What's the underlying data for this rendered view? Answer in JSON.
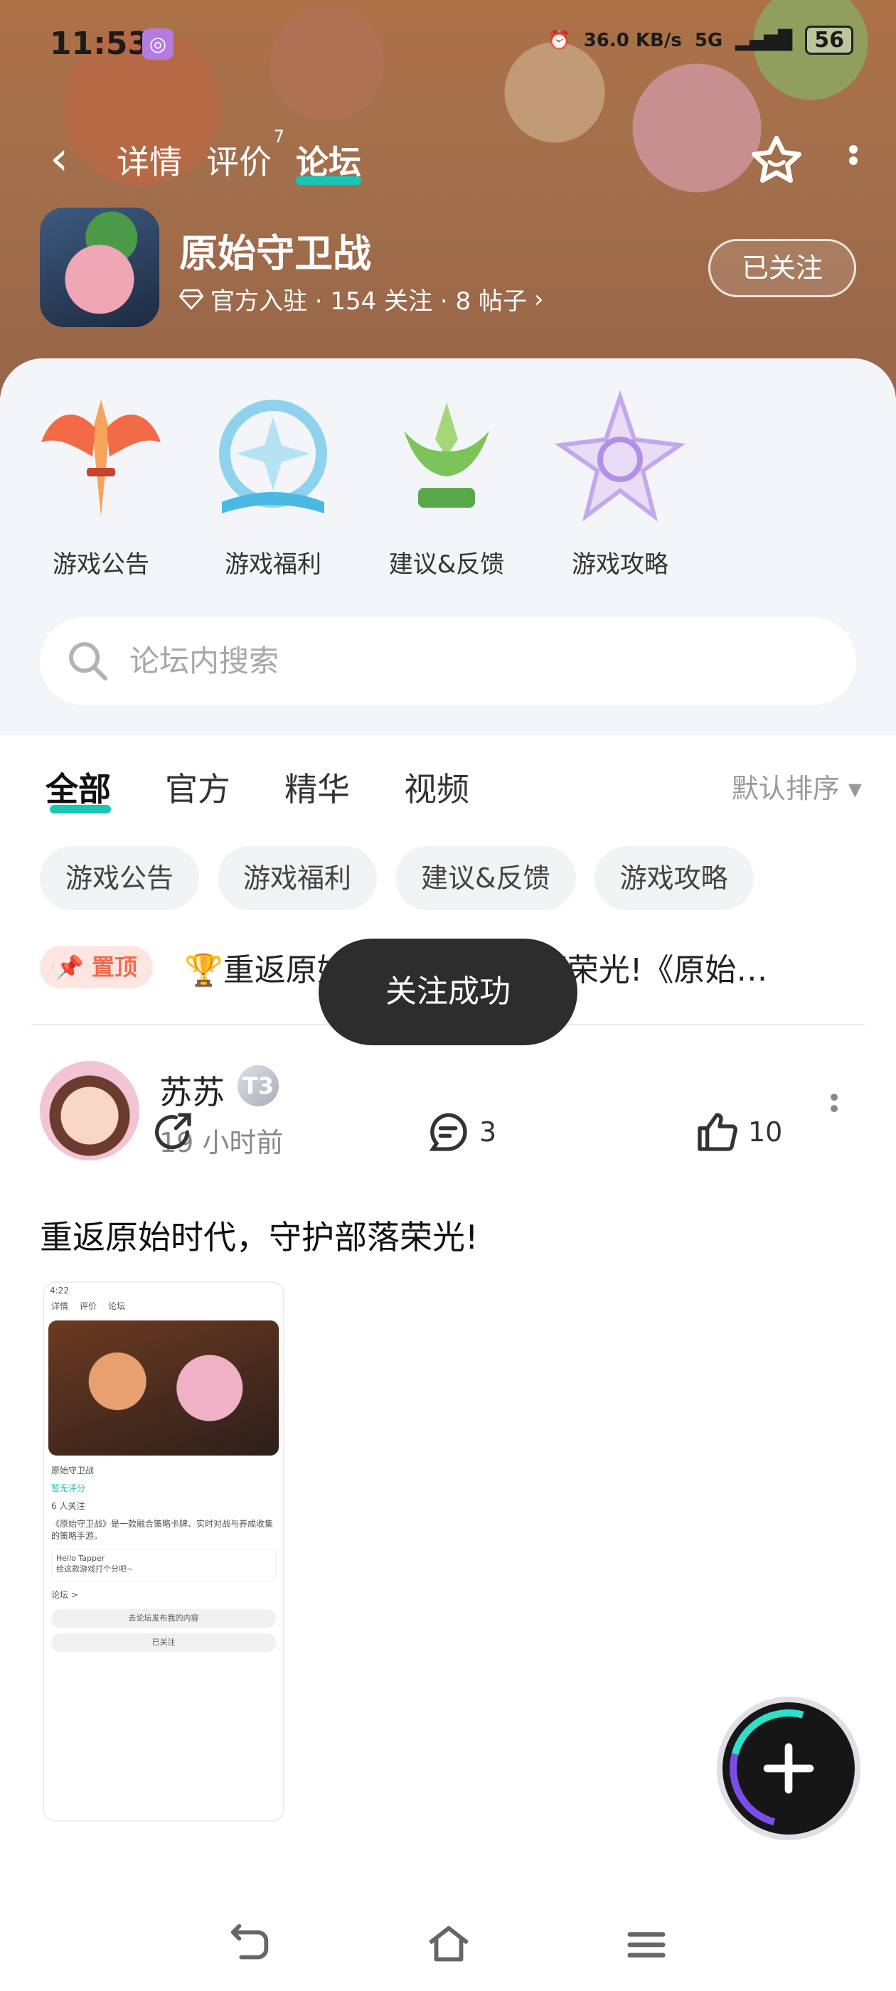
{
  "status_bar": {
    "time": "11:53",
    "network_speed": "36.0 KB/s",
    "network_type": "5G",
    "battery": "56"
  },
  "top_nav": {
    "tabs": [
      {
        "label": "详情"
      },
      {
        "label": "评价",
        "badge": "7"
      },
      {
        "label": "论坛"
      }
    ]
  },
  "app": {
    "name": "原始守卫战",
    "meta": "官方入驻 · 154 关注 · 8 帖子",
    "follow_label": "已关注"
  },
  "categories": [
    {
      "label": "游戏公告"
    },
    {
      "label": "游戏福利"
    },
    {
      "label": "建议&反馈"
    },
    {
      "label": "游戏攻略"
    }
  ],
  "search": {
    "placeholder": "论坛内搜索"
  },
  "feed_tabs": [
    {
      "label": "全部"
    },
    {
      "label": "官方"
    },
    {
      "label": "精华"
    },
    {
      "label": "视频"
    }
  ],
  "sort_label": "默认排序",
  "chips": [
    {
      "label": "游戏公告"
    },
    {
      "label": "游戏福利"
    },
    {
      "label": "建议&反馈"
    },
    {
      "label": "游戏攻略"
    }
  ],
  "pinned": {
    "badge": "置顶",
    "title": "🏆重返原始时代，守护部落荣光!《原始…"
  },
  "post": {
    "author": "苏苏",
    "level": "T3",
    "time": "19 小时前",
    "title": "重返原始时代，守护部落荣光!",
    "thumb": {
      "time": "4:22",
      "tabs": [
        "详情",
        "评价",
        "论坛"
      ],
      "app_name": "原始守卫战",
      "rating_label": "暂无评分",
      "follows": "6 人关注",
      "desc": "《原始守卫战》是一款融合策略卡牌、实时对战与养成收集的策略手游。",
      "review_user": "Hello Tapper",
      "review_text": "给这款游戏打个分吧~",
      "forum_label": "论坛 >",
      "forum_pill": "去论坛发布我的内容",
      "follow_pill": "已关注"
    },
    "comments": "3",
    "likes": "10"
  },
  "toast": "关注成功",
  "colors": {
    "accent": "#17c6b5",
    "pin": "#f26b4d"
  }
}
